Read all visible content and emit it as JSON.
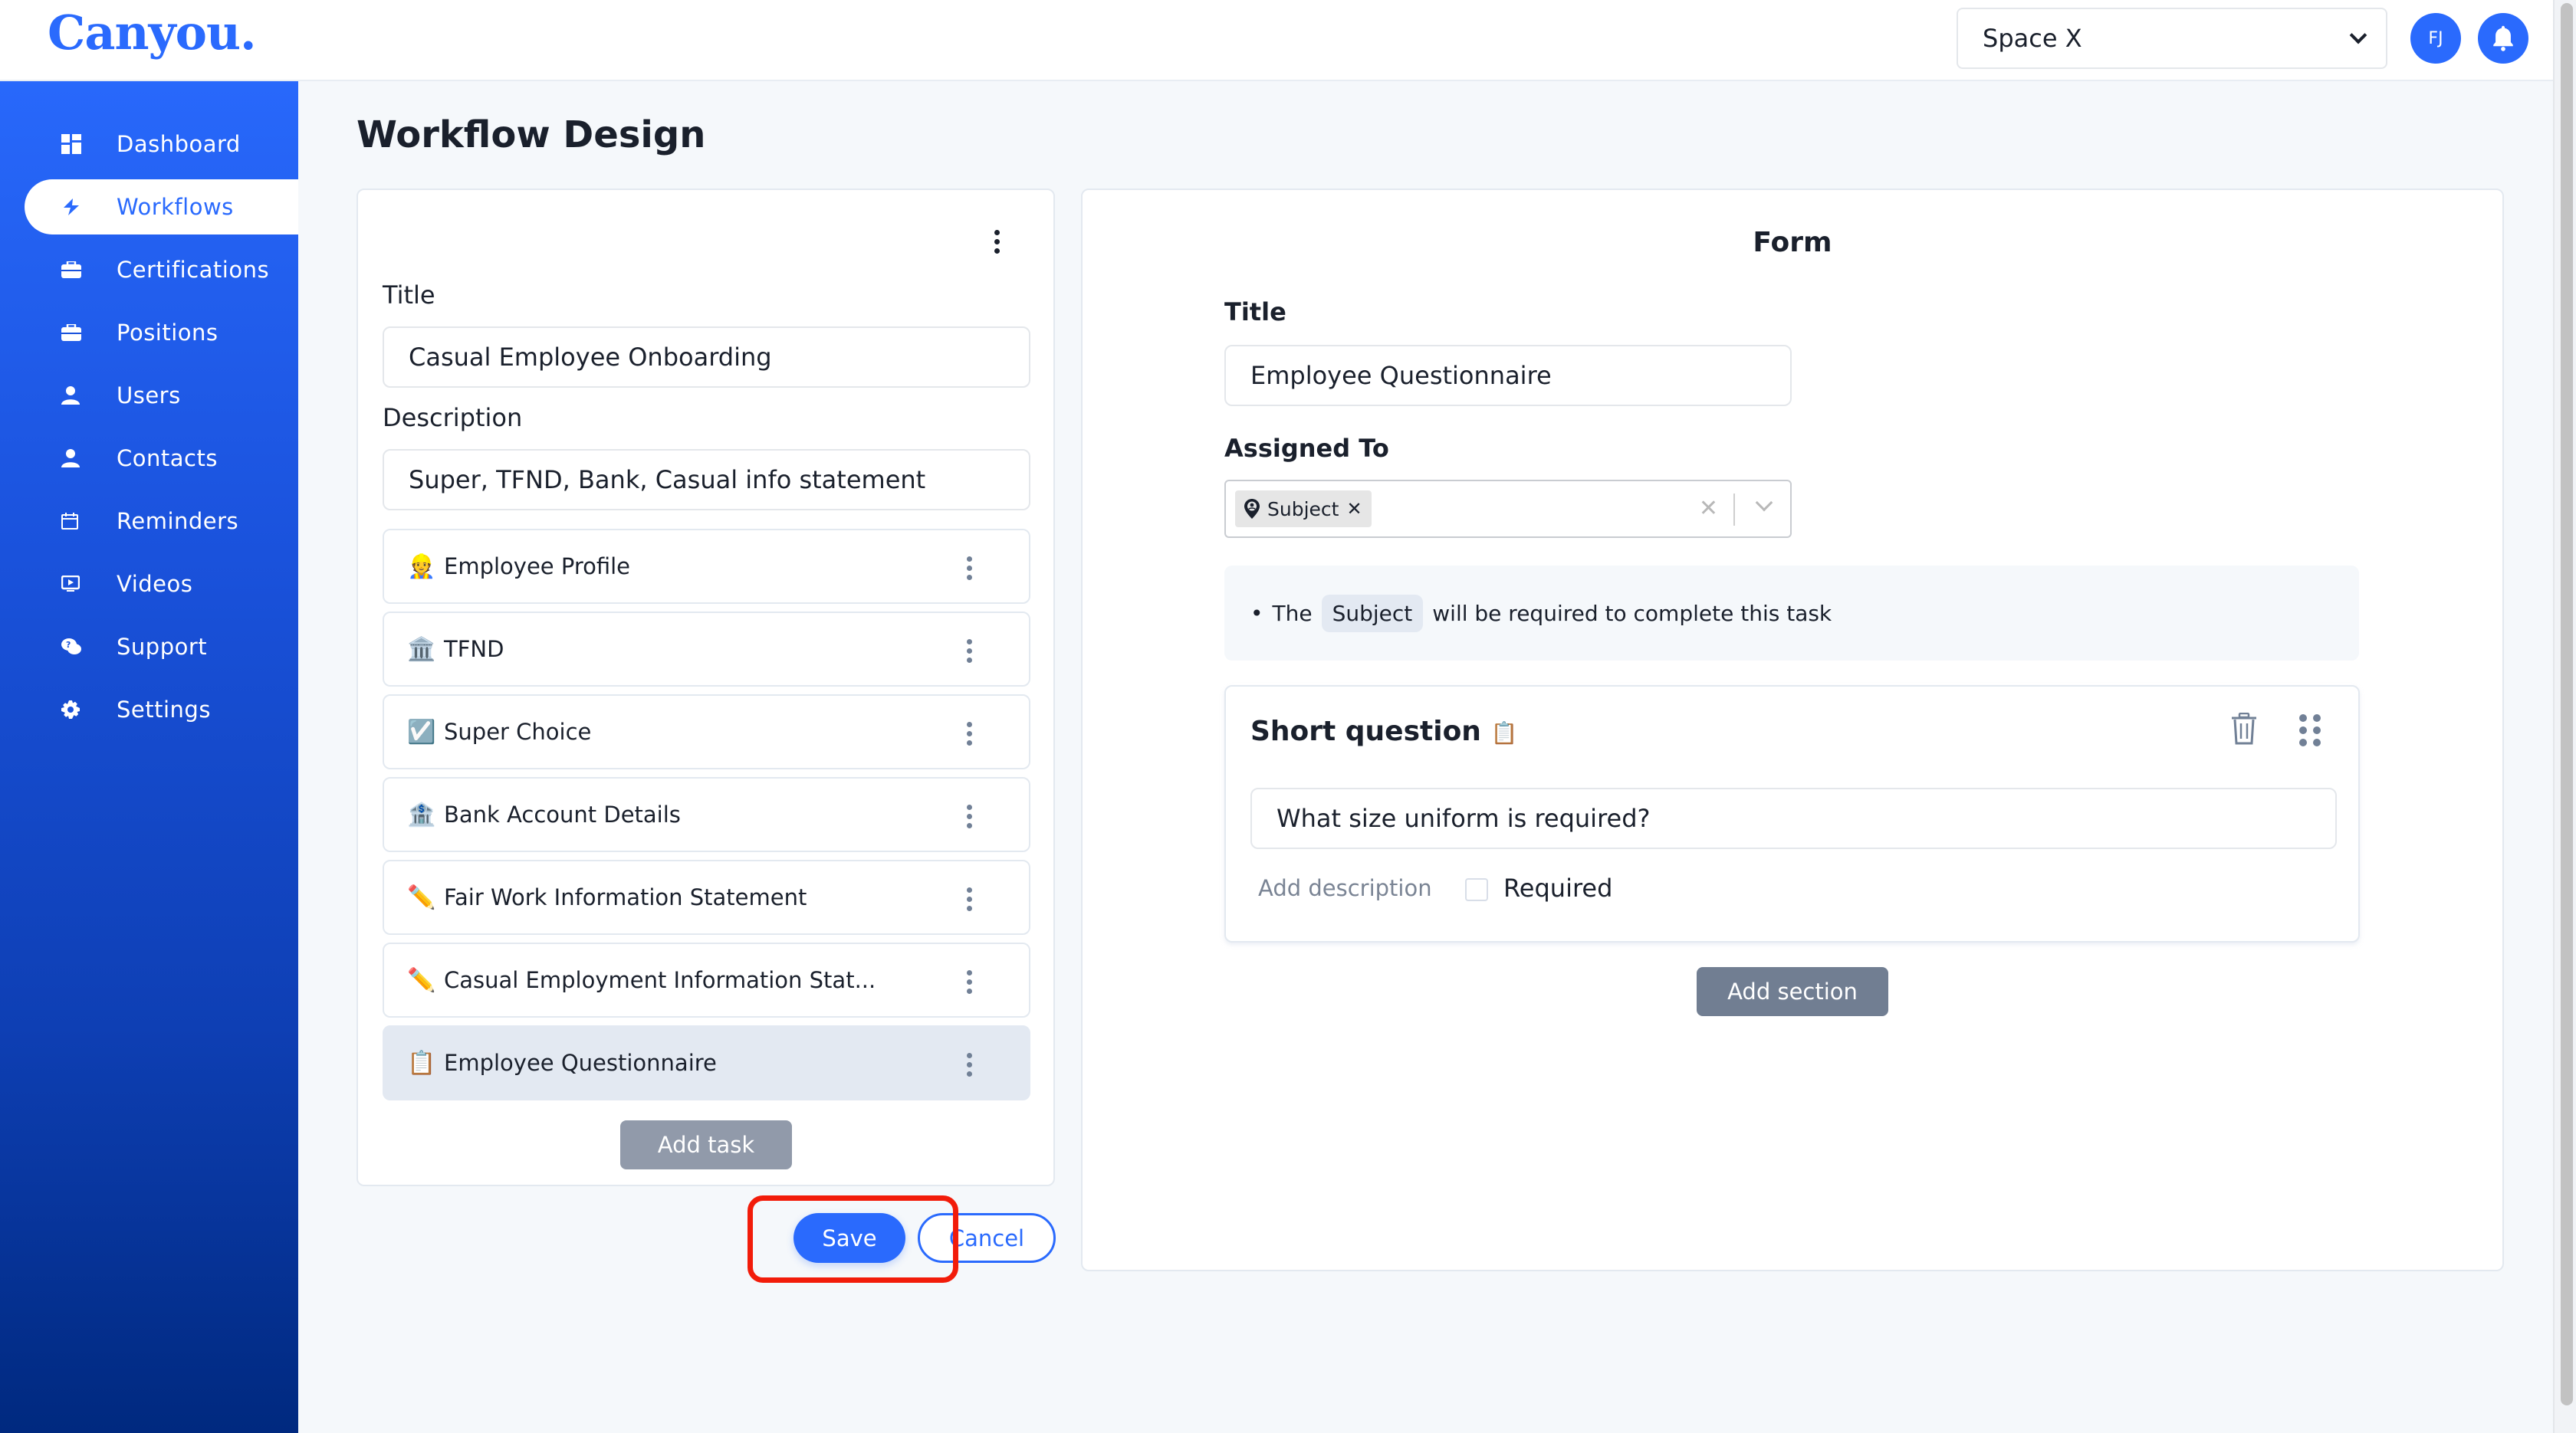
{
  "app": {
    "logo": "Canyou.",
    "workspace_select": {
      "value": "Space X"
    },
    "avatar_initials": "FJ",
    "notifications_icon": "bell-icon"
  },
  "sidebar": {
    "items": [
      {
        "label": "Dashboard",
        "icon": "dashboard-icon",
        "active": false
      },
      {
        "label": "Workflows",
        "icon": "bolt-icon",
        "active": true
      },
      {
        "label": "Certifications",
        "icon": "briefcase-icon",
        "active": false
      },
      {
        "label": "Positions",
        "icon": "briefcase-icon",
        "active": false
      },
      {
        "label": "Users",
        "icon": "user-icon",
        "active": false
      },
      {
        "label": "Contacts",
        "icon": "user-icon",
        "active": false
      },
      {
        "label": "Reminders",
        "icon": "calendar-icon",
        "active": false
      },
      {
        "label": "Videos",
        "icon": "video-icon",
        "active": false
      },
      {
        "label": "Support",
        "icon": "support-chat-icon",
        "active": false
      },
      {
        "label": "Settings",
        "icon": "gear-icon",
        "active": false
      }
    ]
  },
  "page": {
    "title": "Workflow Design"
  },
  "workflow": {
    "title_label": "Title",
    "title_value": "Casual Employee Onboarding",
    "description_label": "Description",
    "description_value": "Super, TFND, Bank, Casual info statement",
    "tasks": [
      {
        "emoji": "👷",
        "label": "Employee Profile",
        "selected": false
      },
      {
        "emoji": "🏛️",
        "label": "TFND",
        "selected": false
      },
      {
        "emoji": "☑️",
        "label": "Super Choice",
        "selected": false
      },
      {
        "emoji": "🏦",
        "label": "Bank Account Details",
        "selected": false
      },
      {
        "emoji": "✏️",
        "label": "Fair Work Information Statement",
        "selected": false
      },
      {
        "emoji": "✏️",
        "label": "Casual Employment Information Stat...",
        "selected": false
      },
      {
        "emoji": "📋",
        "label": "Employee Questionnaire",
        "selected": true
      }
    ],
    "add_task_label": "Add task",
    "save_label": "Save",
    "cancel_label": "Cancel"
  },
  "form": {
    "heading": "Form",
    "title_label": "Title",
    "title_value": "Employee Questionnaire",
    "assigned_label": "Assigned To",
    "assigned_chips": [
      {
        "label": "Subject",
        "icon": "location-pin-icon"
      }
    ],
    "info_prefix": "The",
    "info_pill": "Subject",
    "info_suffix": "will be required to complete this task",
    "question": {
      "type_label": "Short question",
      "type_emoji": "📋",
      "text_value": "What size uniform is required?",
      "add_description_label": "Add description",
      "required_label": "Required",
      "required_checked": false
    },
    "add_section_label": "Add section"
  },
  "colors": {
    "brand": "#2a6afd",
    "highlight": "#f21c0a",
    "sidebar_top": "#2868fb",
    "sidebar_bottom": "#00297f"
  }
}
